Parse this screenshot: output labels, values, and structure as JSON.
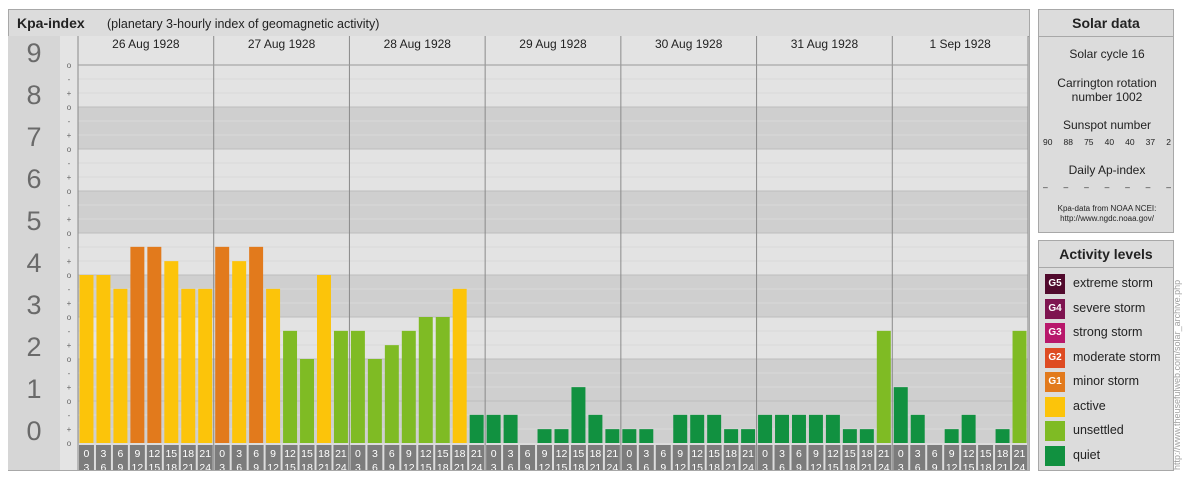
{
  "header": {
    "title": "Kpa-index",
    "subtitle": "(planetary 3-hourly index of geomagnetic activity)"
  },
  "chart_data": {
    "type": "bar",
    "ylim": [
      0,
      9
    ],
    "y_ticks": [
      "0",
      "1",
      "2",
      "3",
      "4",
      "5",
      "6",
      "7",
      "8",
      "9"
    ],
    "sub_ticks": [
      "o",
      "+",
      "-"
    ],
    "days": [
      "26 Aug 1928",
      "27 Aug 1928",
      "28 Aug 1928",
      "29 Aug 1928",
      "30 Aug 1928",
      "31 Aug 1928",
      "1 Sep 1928"
    ],
    "hour_starts": [
      "0",
      "3",
      "6",
      "9",
      "12",
      "15",
      "18",
      "21"
    ],
    "hour_ends": [
      "3",
      "6",
      "9",
      "12",
      "15",
      "18",
      "21",
      "24"
    ],
    "values": [
      4.0,
      4.0,
      3.67,
      4.67,
      4.67,
      4.33,
      3.67,
      3.67,
      4.67,
      4.33,
      4.67,
      3.67,
      2.67,
      2.0,
      4.0,
      2.67,
      2.67,
      2.0,
      2.33,
      2.67,
      3.0,
      3.0,
      3.67,
      0.67,
      0.67,
      0.67,
      0.0,
      0.33,
      0.33,
      1.33,
      0.67,
      0.33,
      0.33,
      0.33,
      0.0,
      0.67,
      0.67,
      0.67,
      0.33,
      0.33,
      0.67,
      0.67,
      0.67,
      0.67,
      0.67,
      0.33,
      0.33,
      2.67,
      1.33,
      0.67,
      0.0,
      0.33,
      0.67,
      0.0,
      0.33,
      2.67
    ],
    "colors": {
      "quiet": "#119140",
      "unsettled": "#7fbb24",
      "active": "#fcc40a",
      "minor": "#e27a1c"
    }
  },
  "solar": {
    "title": "Solar data",
    "cycle": "Solar cycle 16",
    "carrington_1": "Carrington rotation",
    "carrington_2": "number 1002",
    "sunspot_label": "Sunspot number",
    "sunspots": [
      "90",
      "88",
      "75",
      "40",
      "40",
      "37",
      "2"
    ],
    "ap_label": "Daily Ap-index",
    "ap": [
      "–",
      "–",
      "–",
      "–",
      "–",
      "–",
      "–"
    ],
    "source_1": "Kpa-data from NOAA NCEI:",
    "source_2": "http://www.ngdc.noaa.gov/"
  },
  "levels": {
    "title": "Activity levels",
    "items": [
      {
        "badge": "G5",
        "label": "extreme storm",
        "color": "#510a2d"
      },
      {
        "badge": "G4",
        "label": "severe storm",
        "color": "#7e1450"
      },
      {
        "badge": "G3",
        "label": "strong storm",
        "color": "#b8186b"
      },
      {
        "badge": "G2",
        "label": "moderate storm",
        "color": "#de4b22"
      },
      {
        "badge": "G1",
        "label": "minor storm",
        "color": "#e27a1c"
      },
      {
        "badge": "",
        "label": "active",
        "color": "#fcc40a"
      },
      {
        "badge": "",
        "label": "unsettled",
        "color": "#7fbb24"
      },
      {
        "badge": "",
        "label": "quiet",
        "color": "#119140"
      }
    ]
  },
  "credit": "http://www.theusefulweb.com/solar_archive.php"
}
